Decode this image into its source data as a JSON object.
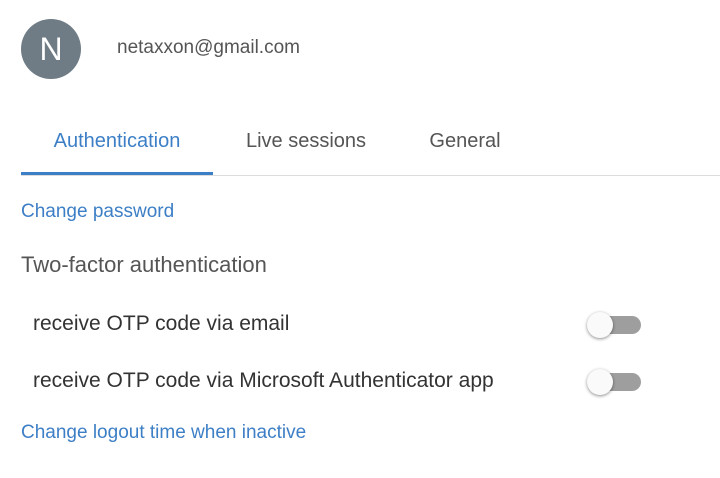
{
  "header": {
    "avatar_initial": "N",
    "email": "netaxxon@gmail.com"
  },
  "tabs": [
    {
      "label": "Authentication",
      "active": true
    },
    {
      "label": "Live sessions",
      "active": false
    },
    {
      "label": "General",
      "active": false
    }
  ],
  "content": {
    "change_password_link": "Change password",
    "two_factor_title": "Two-factor authentication",
    "otp_options": [
      {
        "label": "receive OTP code via email",
        "enabled": false
      },
      {
        "label": "receive OTP code via Microsoft Authenticator app",
        "enabled": false
      }
    ],
    "change_logout_link": "Change logout time when inactive"
  },
  "colors": {
    "accent": "#3d7fc6",
    "avatar_bg": "#6f7c85",
    "text": "#555555",
    "toggle_track_off": "#9e9e9e"
  }
}
